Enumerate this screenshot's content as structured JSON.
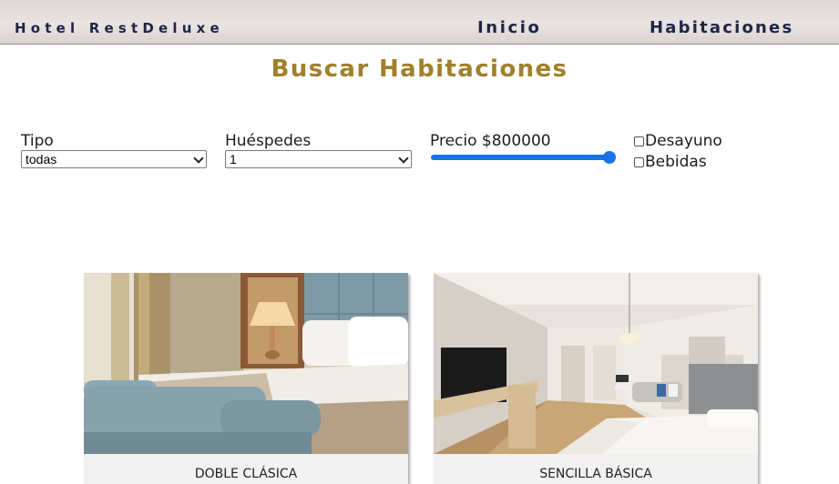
{
  "navbar": {
    "brand": "Hotel RestDeluxe",
    "links": [
      "Inicio",
      "Habitaciones"
    ]
  },
  "page_title": "Buscar Habitaciones",
  "filters": {
    "tipo": {
      "label": "Tipo",
      "selected": "todas"
    },
    "huespedes": {
      "label": "Huéspedes",
      "selected": "1"
    },
    "precio": {
      "label": "Precio $800000",
      "value": 800000,
      "fill_fraction": 1.0
    },
    "checkboxes": [
      {
        "label": "Desayuno",
        "checked": false
      },
      {
        "label": "Bebidas",
        "checked": false
      }
    ]
  },
  "rooms": [
    {
      "name": "DOBLE CLÁSICA",
      "image": "classic-double-room-photo"
    },
    {
      "name": "SENCILLA BÁSICA",
      "image": "basic-single-room-photo"
    }
  ],
  "colors": {
    "brand_navy": "#1e2545",
    "title_gold": "#a0802b",
    "slider_blue": "#1a73e8",
    "navbar_bg": "#e2dcd9"
  }
}
